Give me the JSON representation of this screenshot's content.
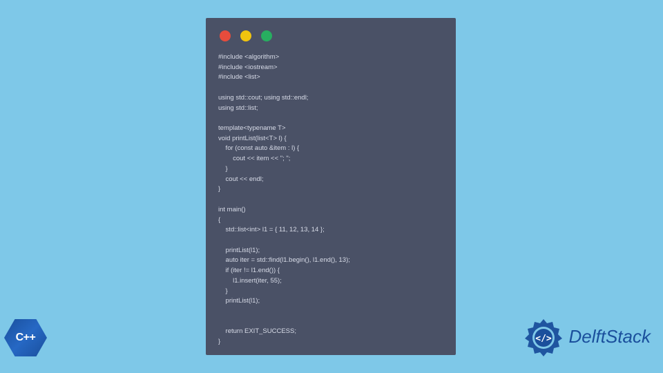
{
  "code_window": {
    "traffic_lights": [
      "red",
      "yellow",
      "green"
    ],
    "code": "#include <algorithm>\n#include <iostream>\n#include <list>\n\nusing std::cout; using std::endl;\nusing std::list;\n\ntemplate<typename T>\nvoid printList(list<T> l) {\n    for (const auto &item : l) {\n        cout << item << \"; \";\n    }\n    cout << endl;\n}\n\nint main()\n{\n    std::list<int> l1 = { 11, 12, 13, 14 };\n\n    printList(l1);\n    auto iter = std::find(l1.begin(), l1.end(), 13);\n    if (iter != l1.end()) {\n        l1.insert(iter, 55);\n    }\n    printList(l1);\n\n\n    return EXIT_SUCCESS;\n}"
  },
  "cpp_badge": {
    "label": "C++"
  },
  "delft_logo": {
    "text": "DelftStack"
  },
  "colors": {
    "background": "#7ec8e8",
    "window_bg": "#4a5166",
    "code_text": "#d8dce8",
    "cpp_blue": "#1a4f9c",
    "delft_blue": "#1a4f9c"
  }
}
